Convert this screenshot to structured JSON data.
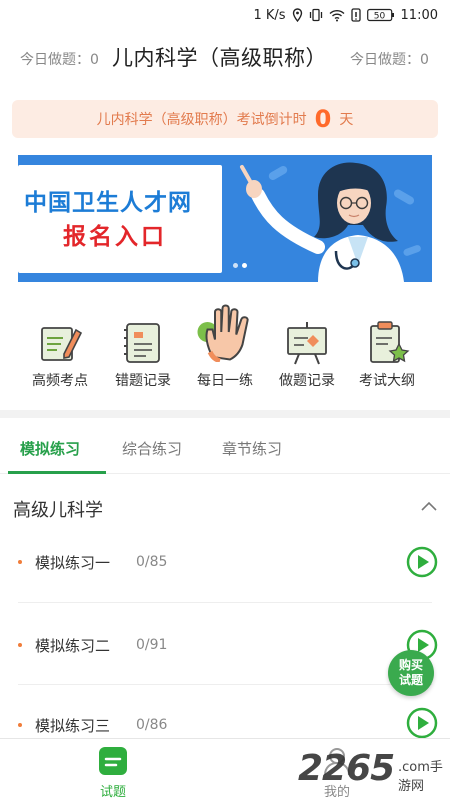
{
  "status_bar": {
    "speed": "1 K/s",
    "battery": "50",
    "time": "11:00"
  },
  "header": {
    "today_label_left": "今日做题：0",
    "title": "儿内科学（高级职称）",
    "today_label_right": "今日做题：0"
  },
  "countdown": {
    "prefix": "儿内科学（高级职称）考试倒计时",
    "days": "0",
    "suffix": "天"
  },
  "banner": {
    "line1": "中国卫生人才网",
    "line2": "报名入口"
  },
  "quick_nav": [
    {
      "label": "高频考点",
      "icon": "pen-paper-icon"
    },
    {
      "label": "错题记录",
      "icon": "notebook-icon"
    },
    {
      "label": "每日一练",
      "icon": "hand-icon"
    },
    {
      "label": "做题记录",
      "icon": "presentation-board-icon"
    },
    {
      "label": "考试大纲",
      "icon": "clipboard-star-icon"
    }
  ],
  "tabs": [
    {
      "label": "模拟练习",
      "active": true
    },
    {
      "label": "综合练习",
      "active": false
    },
    {
      "label": "章节练习",
      "active": false
    }
  ],
  "section": {
    "title": "高级儿科学"
  },
  "exercises": [
    {
      "title": "模拟练习一",
      "count": "0/85"
    },
    {
      "title": "模拟练习二",
      "count": "0/91"
    },
    {
      "title": "模拟练习三",
      "count": "0/86"
    }
  ],
  "buy_button": {
    "line1": "购买",
    "line2": "试题"
  },
  "bottom_nav": [
    {
      "label": "试题",
      "active": true
    },
    {
      "label": "我的",
      "active": false
    }
  ],
  "watermark": {
    "number": "2265",
    "text": ".com手游网"
  },
  "colors": {
    "accent": "#27a04b",
    "countdown_bg": "#fdece3",
    "countdown_text": "#e27b4e",
    "banner_bg": "#2f7fd9"
  }
}
